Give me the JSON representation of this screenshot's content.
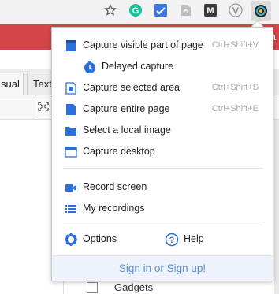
{
  "colors": {
    "accent_blue": "#2a6fdb",
    "banner_red": "#d6454a",
    "shortcut_gray": "#a8a8a8",
    "footer_bg": "#eef3fb",
    "footer_link": "#5a8fd8"
  },
  "browser": {
    "banner_char": "a",
    "extensions": [
      {
        "name": "star-icon"
      },
      {
        "name": "grammarly-icon"
      },
      {
        "name": "check-extension-icon"
      },
      {
        "name": "pdf-icon"
      },
      {
        "name": "m-extension-icon"
      },
      {
        "name": "v-extension-icon"
      },
      {
        "name": "screenshot-extension-icon"
      }
    ]
  },
  "page": {
    "tab_visual": "sual",
    "tab_text": "Text",
    "gadgets_label": "Gadgets"
  },
  "popup": {
    "items": [
      {
        "label": "Capture visible part of page",
        "shortcut": "Ctrl+Shift+V",
        "icon": "page-icon"
      },
      {
        "label": "Delayed capture",
        "shortcut": "",
        "icon": "clock-icon"
      },
      {
        "label": "Capture selected area",
        "shortcut": "Ctrl+Shift+S",
        "icon": "selection-icon"
      },
      {
        "label": "Capture entire page",
        "shortcut": "Ctrl+Shift+E",
        "icon": "page-full-icon"
      },
      {
        "label": "Select a local image",
        "shortcut": "",
        "icon": "folder-icon"
      },
      {
        "label": "Capture desktop",
        "shortcut": "",
        "icon": "window-icon"
      }
    ],
    "recording": [
      {
        "label": "Record screen",
        "icon": "video-camera-icon"
      },
      {
        "label": "My recordings",
        "icon": "list-icon"
      }
    ],
    "options_label": "Options",
    "help_label": "Help",
    "footer_link": "Sign in or Sign up!"
  }
}
